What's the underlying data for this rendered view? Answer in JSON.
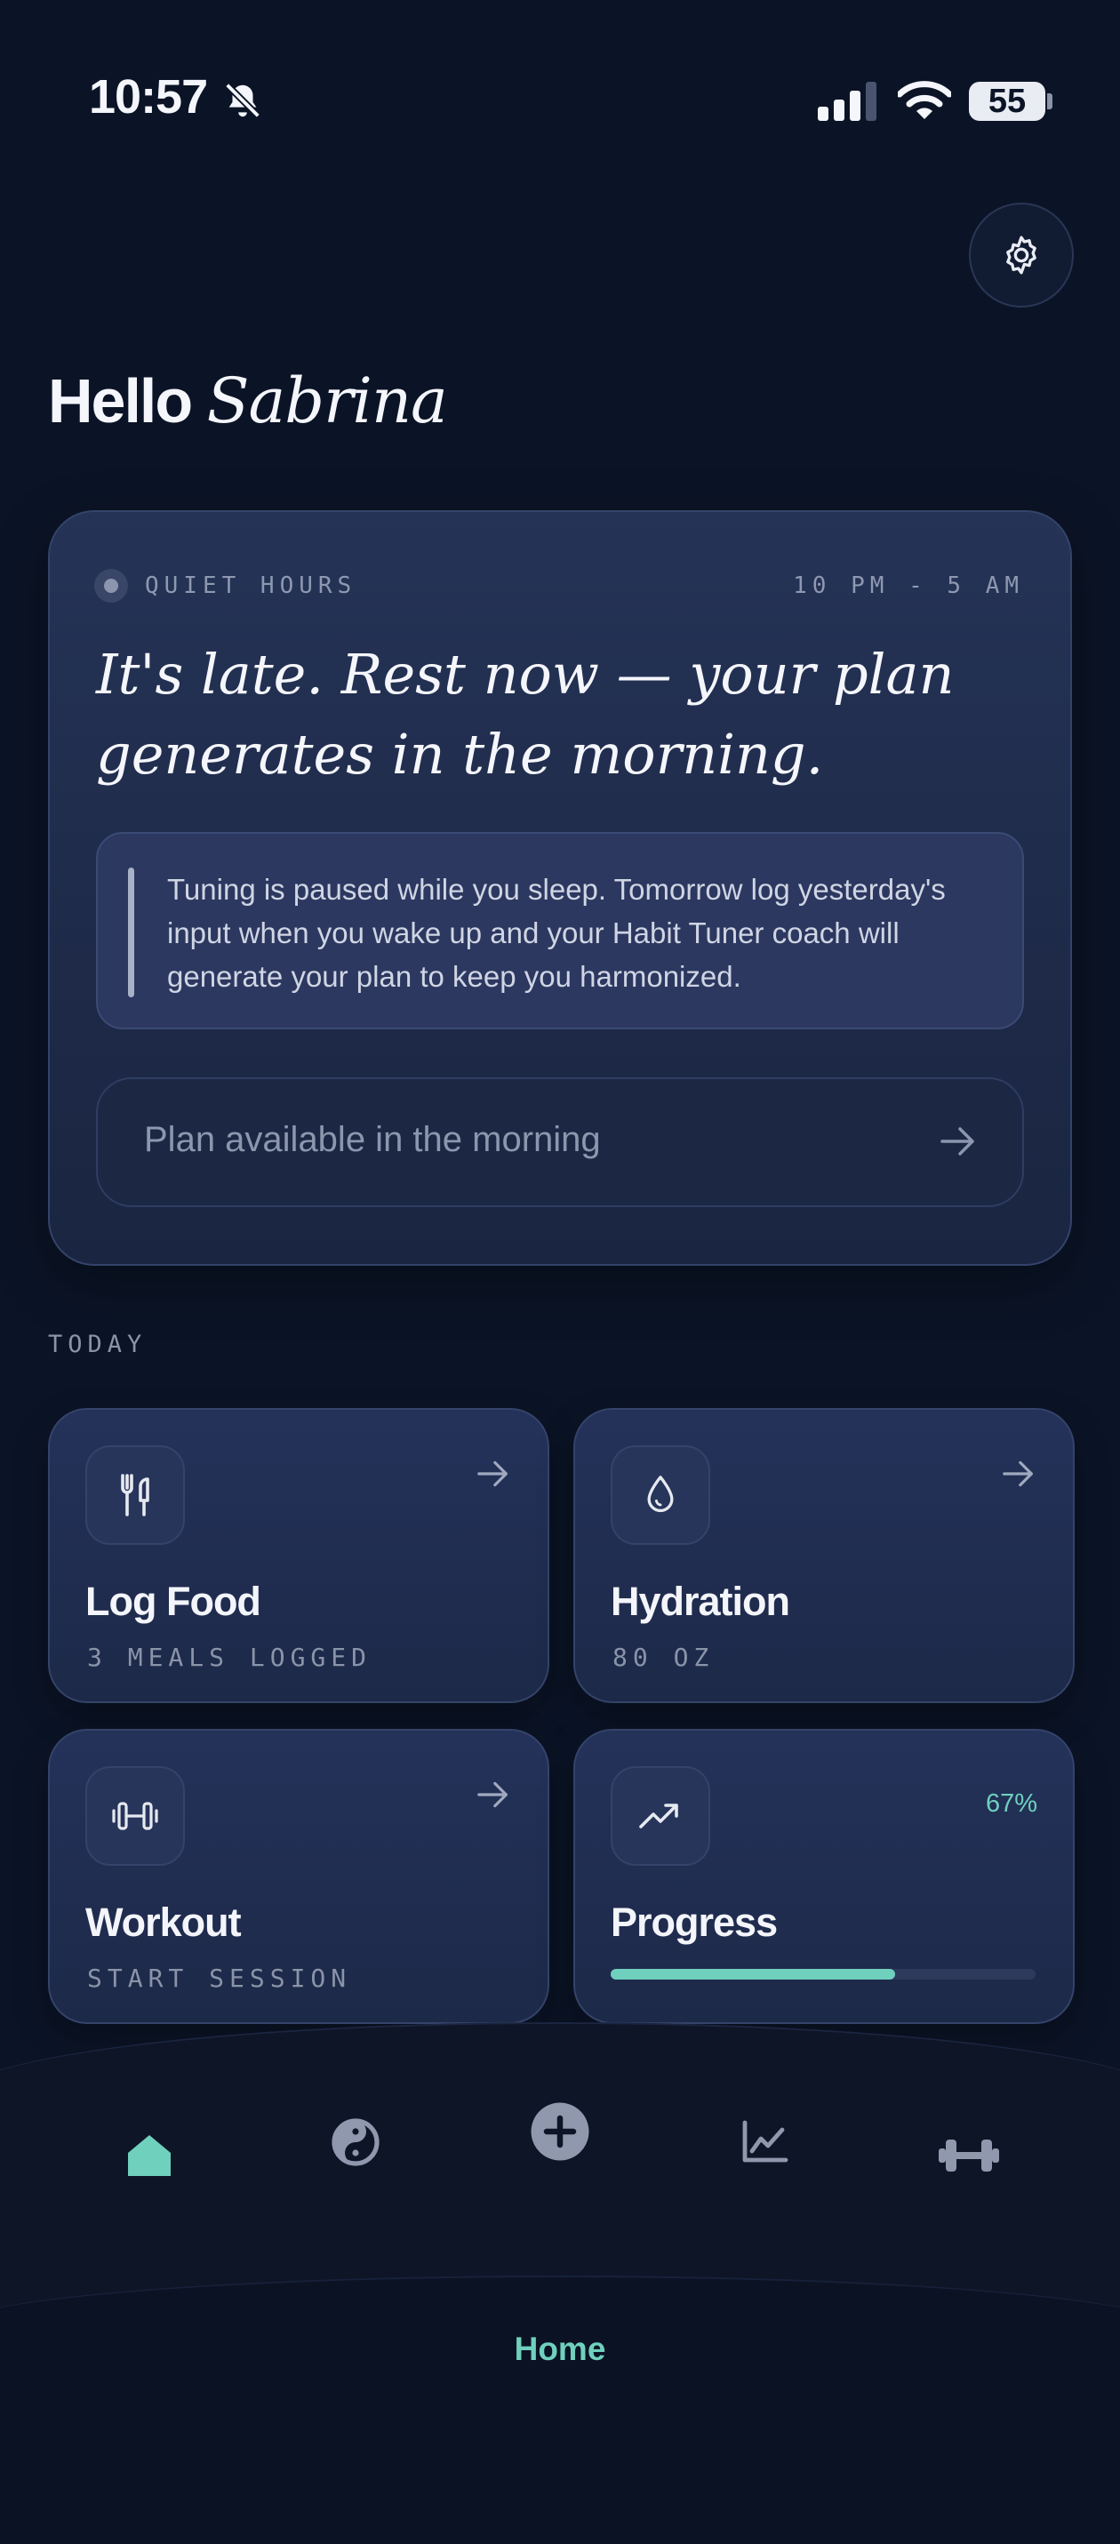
{
  "status_bar": {
    "time": "10:57",
    "battery": "55",
    "icons": [
      "bell-slash-icon",
      "signal-icon",
      "wifi-icon",
      "battery-icon"
    ]
  },
  "header": {
    "greeting": "Hello",
    "name": "Sabrina",
    "settings_icon": "gear-icon"
  },
  "quiet_hours": {
    "label": "QUIET HOURS",
    "range": "10 PM - 5 AM",
    "headline": "It's late. Rest now — your plan generates in the morning.",
    "note": "Tuning is paused while you sleep. Tomorrow log yesterday's input when you wake up and your Habit Tuner coach will generate your plan to keep you harmonized.",
    "button_label": "Plan available in the morning"
  },
  "today": {
    "label": "TODAY",
    "tiles": [
      {
        "title": "Log Food",
        "subtitle": "3 MEALS LOGGED",
        "icon": "fork-knife-icon"
      },
      {
        "title": "Hydration",
        "subtitle": "80 OZ",
        "icon": "water-drop-icon"
      },
      {
        "title": "Workout",
        "subtitle": "START SESSION",
        "icon": "dumbbell-icon"
      },
      {
        "title": "Progress",
        "percent_label": "67%",
        "progress": 0.67,
        "icon": "trend-up-icon"
      }
    ]
  },
  "bottom_nav": {
    "items": [
      "home-icon",
      "yin-yang-icon",
      "add-icon",
      "chart-icon",
      "dumbbell-icon"
    ],
    "active_label": "Home"
  },
  "colors": {
    "background": "#0b1426",
    "card": "#1e2a48",
    "accent": "#6fd0bd",
    "muted": "#8a93a8"
  }
}
